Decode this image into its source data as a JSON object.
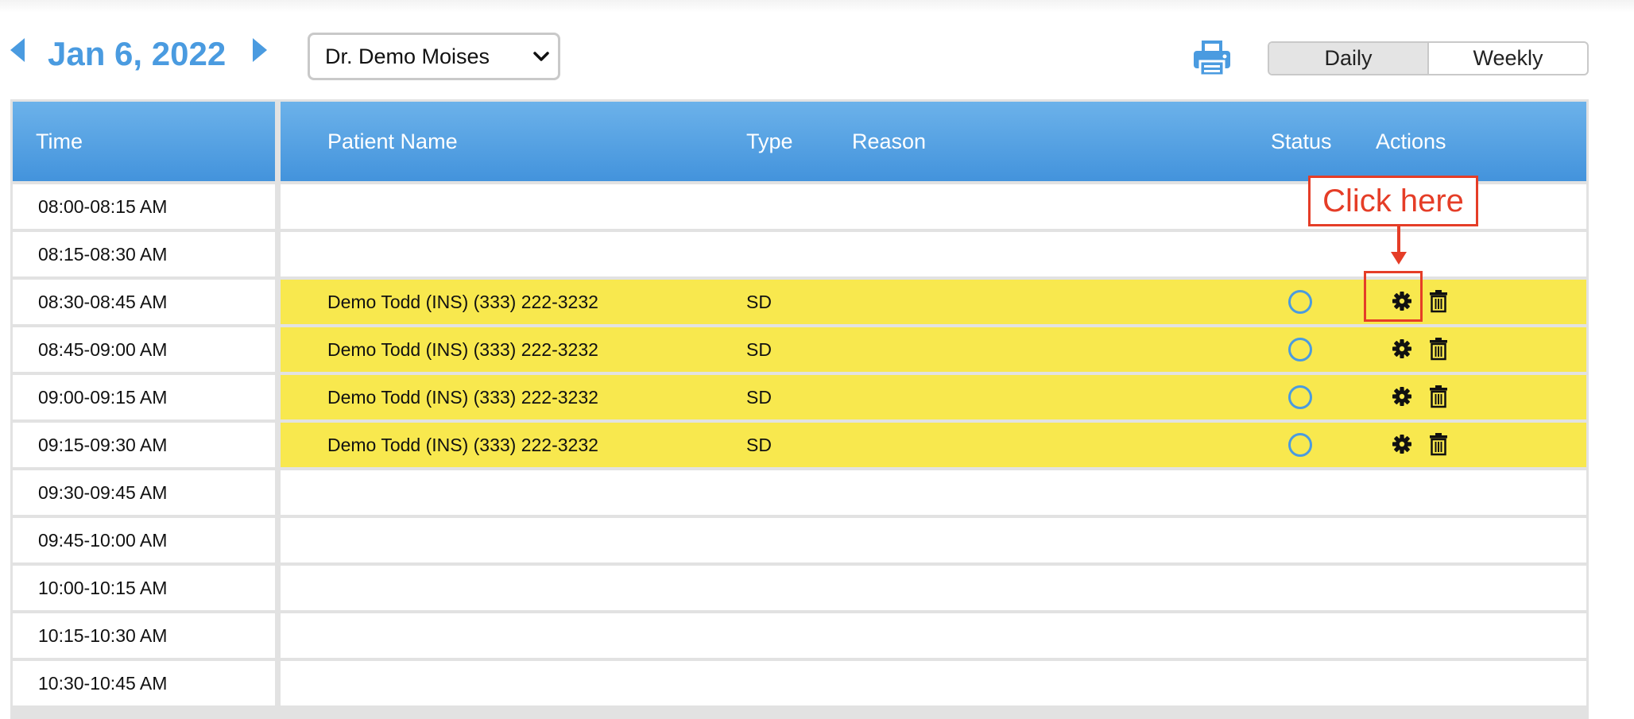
{
  "header": {
    "date": "Jan 6, 2022",
    "doctor_selected": "Dr. Demo Moises",
    "view_options": [
      "Daily",
      "Weekly"
    ],
    "active_view": "Daily"
  },
  "columns": {
    "time": "Time",
    "patient_name": "Patient Name",
    "type": "Type",
    "reason": "Reason",
    "status": "Status",
    "actions": "Actions"
  },
  "rows": [
    {
      "time": "08:00-08:15 AM",
      "patient": "",
      "type": "",
      "booked": false
    },
    {
      "time": "08:15-08:30 AM",
      "patient": "",
      "type": "",
      "booked": false
    },
    {
      "time": "08:30-08:45 AM",
      "patient": "Demo Todd (INS)  (333) 222-3232",
      "type": "SD",
      "booked": true
    },
    {
      "time": "08:45-09:00 AM",
      "patient": "Demo Todd (INS)  (333) 222-3232",
      "type": "SD",
      "booked": true
    },
    {
      "time": "09:00-09:15 AM",
      "patient": "Demo Todd (INS)  (333) 222-3232",
      "type": "SD",
      "booked": true
    },
    {
      "time": "09:15-09:30 AM",
      "patient": "Demo Todd (INS)  (333) 222-3232",
      "type": "SD",
      "booked": true
    },
    {
      "time": "09:30-09:45 AM",
      "patient": "",
      "type": "",
      "booked": false
    },
    {
      "time": "09:45-10:00 AM",
      "patient": "",
      "type": "",
      "booked": false
    },
    {
      "time": "10:00-10:15 AM",
      "patient": "",
      "type": "",
      "booked": false
    },
    {
      "time": "10:15-10:30 AM",
      "patient": "",
      "type": "",
      "booked": false
    },
    {
      "time": "10:30-10:45 AM",
      "patient": "",
      "type": "",
      "booked": false
    }
  ],
  "annotation": {
    "label": "Click here"
  },
  "colors": {
    "accent_blue": "#4a9be0",
    "header_gradient_top": "#6cb2ea",
    "header_gradient_bottom": "#4393dc",
    "booked_row": "#f8e84e",
    "annotation_red": "#e53d27"
  },
  "icons": {
    "prev": "triangle-left-icon",
    "next": "triangle-right-icon",
    "print": "printer-icon",
    "status": "circle-status-icon",
    "edit": "gear-icon",
    "delete": "trash-icon"
  }
}
